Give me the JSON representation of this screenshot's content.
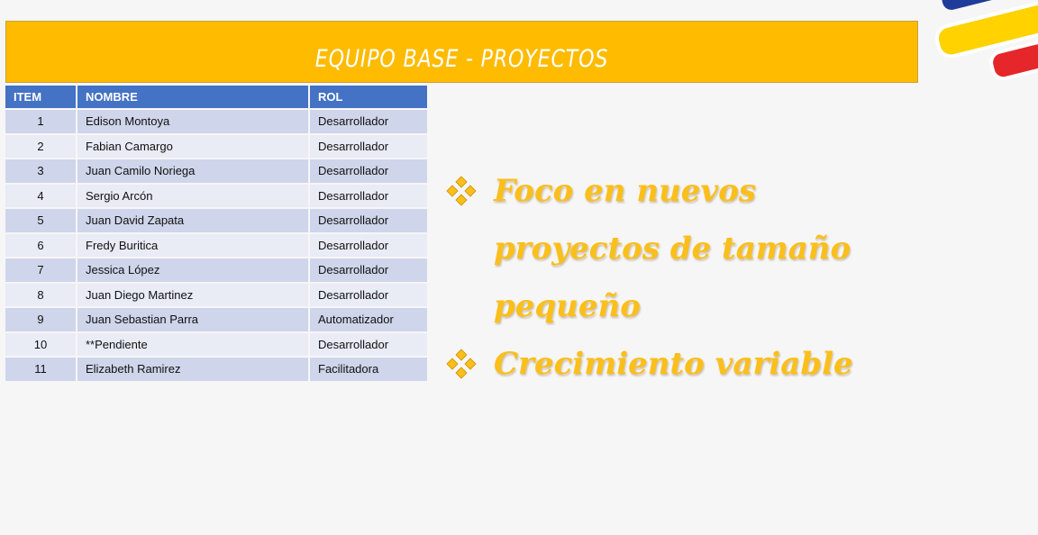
{
  "header": {
    "title": "EQUIPO BASE - PROYECTOS"
  },
  "table": {
    "columns": [
      "ITEM",
      "NOMBRE",
      "ROL"
    ],
    "rows": [
      {
        "item": "1",
        "nombre": "Edison Montoya",
        "rol": "Desarrollador"
      },
      {
        "item": "2",
        "nombre": "Fabian Camargo",
        "rol": "Desarrollador"
      },
      {
        "item": "3",
        "nombre": "Juan Camilo Noriega",
        "rol": "Desarrollador"
      },
      {
        "item": "4",
        "nombre": "Sergio Arcón",
        "rol": "Desarrollador"
      },
      {
        "item": "5",
        "nombre": "Juan David Zapata",
        "rol": "Desarrollador"
      },
      {
        "item": "6",
        "nombre": "Fredy Buritica",
        "rol": "Desarrollador"
      },
      {
        "item": "7",
        "nombre": "Jessica López",
        "rol": "Desarrollador"
      },
      {
        "item": "8",
        "nombre": "Juan Diego Martinez",
        "rol": "Desarrollador"
      },
      {
        "item": "9",
        "nombre": "Juan Sebastian Parra",
        "rol": "Automatizador"
      },
      {
        "item": "10",
        "nombre": "**Pendiente",
        "rol": "Desarrollador"
      },
      {
        "item": "11",
        "nombre": "Elizabeth Ramirez",
        "rol": "Facilitadora"
      }
    ]
  },
  "bullets": [
    {
      "text": "Foco en nuevos proyectos de tamaño pequeño",
      "icon": "diamond-cluster-icon"
    },
    {
      "text": "Crecimiento variable",
      "icon": "diamond-cluster-icon"
    }
  ],
  "colors": {
    "banner": "#ffbb00",
    "table_header": "#4472c4",
    "row_odd": "#cfd5ea",
    "row_even": "#e9ebf5",
    "bullet_text": "#fbbf1a",
    "logo_yellow": "#ffd200",
    "logo_blue": "#1f3c9a",
    "logo_red": "#e5262b"
  },
  "logo": {
    "icon": "colombia-flag-logo-icon"
  }
}
